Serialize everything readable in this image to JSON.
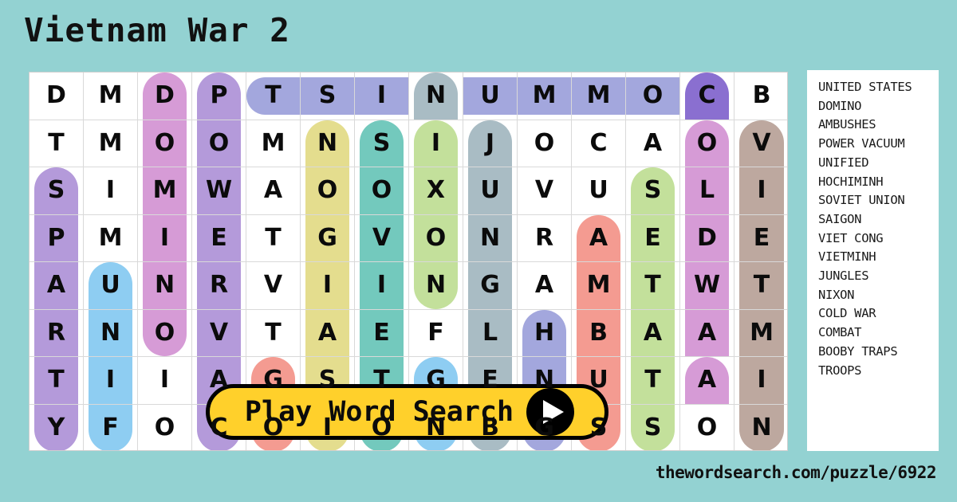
{
  "page": {
    "background_color": "#93d2d2",
    "title": "Vietnam War 2",
    "footer_url": "thewordsearch.com/puzzle/6922"
  },
  "play_button": {
    "label": "Play Word Search",
    "icon": "play-triangle-icon",
    "background_color": "#ffd02b",
    "text_color": "#0b0b0b"
  },
  "word_list": {
    "background_color": "#ffffff",
    "words": [
      "UNITED STATES",
      "DOMINO",
      "AMBUSHES",
      "POWER VACUUM",
      "UNIFIED",
      "HOCHIMINH",
      "SOVIET UNION",
      "SAIGON",
      "VIET CONG",
      "VIETMINH",
      "JUNGLES",
      "NIXON",
      "COLD WAR",
      "COMBAT",
      "BOOBY TRAPS",
      "TROOPS"
    ]
  },
  "grid": {
    "columns": 14,
    "rows": 8,
    "cell_background": "#ffffff",
    "border_color": "#d9d9d9",
    "highlight_colors": {
      "periwinkle": "#a3a7dd",
      "orchid": "#d69bd6",
      "violet": "#b49ada",
      "khaki": "#e4dd8e",
      "teal": "#73c9bd",
      "celery": "#c3e09b",
      "slate": "#a9bcc4",
      "salmon": "#f49b91",
      "taupe": "#bda89f",
      "sky": "#8ecdf2",
      "purple": "#8a6fd0"
    },
    "letters": [
      [
        "D",
        "M",
        "D",
        "P",
        "T",
        "S",
        "I",
        "N",
        "U",
        "M",
        "M",
        "O",
        "C",
        "B"
      ],
      [
        "T",
        "M",
        "O",
        "O",
        "M",
        "N",
        "S",
        "I",
        "J",
        "O",
        "C",
        "A",
        "O",
        "V"
      ],
      [
        "S",
        "I",
        "M",
        "W",
        "A",
        "O",
        "O",
        "X",
        "U",
        "V",
        "U",
        "S",
        "L",
        "I"
      ],
      [
        "P",
        "M",
        "I",
        "E",
        "T",
        "G",
        "V",
        "O",
        "N",
        "R",
        "A",
        "E",
        "D",
        "E"
      ],
      [
        "A",
        "U",
        "N",
        "R",
        "V",
        "I",
        "I",
        "N",
        "G",
        "A",
        "M",
        "T",
        "W",
        "T"
      ],
      [
        "R",
        "N",
        "O",
        "V",
        "T",
        "A",
        "E",
        "F",
        "L",
        "H",
        "B",
        "A",
        "A",
        "M"
      ],
      [
        "T",
        "I",
        "I",
        "A",
        "G",
        "S",
        "T",
        "G",
        "E",
        "N",
        "U",
        "T",
        "A",
        "I"
      ],
      [
        "Y",
        "F",
        "O",
        "C",
        "O",
        "I",
        "O",
        "N",
        "B",
        "G",
        "S",
        "S",
        "O",
        "N"
      ]
    ],
    "highlights": [
      [
        null,
        null,
        {
          "c": "orchid",
          "cap": "top"
        },
        {
          "c": "violet",
          "cap": "top"
        },
        {
          "c": "periwinkle",
          "cap": "left",
          "h": true
        },
        {
          "c": "periwinkle",
          "h": true
        },
        {
          "c": "periwinkle",
          "h": true
        },
        {
          "c": "slate",
          "cap": "top"
        },
        {
          "c": "periwinkle",
          "h": true
        },
        {
          "c": "periwinkle",
          "h": true
        },
        {
          "c": "periwinkle",
          "h": true
        },
        {
          "c": "periwinkle",
          "h": true
        },
        {
          "c": "purple",
          "cap": "top"
        },
        null
      ],
      [
        null,
        null,
        {
          "c": "orchid"
        },
        {
          "c": "violet"
        },
        null,
        {
          "c": "khaki",
          "cap": "top"
        },
        {
          "c": "teal",
          "cap": "top"
        },
        {
          "c": "celery",
          "cap": "top"
        },
        {
          "c": "slate",
          "cap": "top"
        },
        null,
        null,
        null,
        {
          "c": "orchid",
          "cap": "top"
        },
        {
          "c": "taupe",
          "cap": "top"
        }
      ],
      [
        {
          "c": "violet",
          "cap": "top"
        },
        null,
        {
          "c": "orchid"
        },
        {
          "c": "violet"
        },
        null,
        {
          "c": "khaki"
        },
        {
          "c": "teal"
        },
        {
          "c": "celery"
        },
        {
          "c": "slate"
        },
        null,
        null,
        {
          "c": "celery",
          "cap": "top"
        },
        {
          "c": "orchid"
        },
        {
          "c": "taupe"
        }
      ],
      [
        {
          "c": "violet"
        },
        null,
        {
          "c": "orchid"
        },
        {
          "c": "violet"
        },
        null,
        {
          "c": "khaki"
        },
        {
          "c": "teal"
        },
        {
          "c": "celery"
        },
        {
          "c": "slate"
        },
        null,
        {
          "c": "salmon",
          "cap": "top"
        },
        {
          "c": "celery"
        },
        {
          "c": "orchid"
        },
        {
          "c": "taupe"
        }
      ],
      [
        {
          "c": "violet"
        },
        {
          "c": "sky",
          "cap": "top"
        },
        {
          "c": "orchid"
        },
        {
          "c": "violet"
        },
        null,
        {
          "c": "khaki"
        },
        {
          "c": "teal"
        },
        {
          "c": "celery",
          "cap": "bottom"
        },
        {
          "c": "slate"
        },
        null,
        {
          "c": "salmon"
        },
        {
          "c": "celery"
        },
        {
          "c": "orchid"
        },
        {
          "c": "taupe"
        }
      ],
      [
        {
          "c": "violet"
        },
        {
          "c": "sky"
        },
        {
          "c": "orchid",
          "cap": "bottom"
        },
        {
          "c": "violet"
        },
        null,
        {
          "c": "khaki"
        },
        {
          "c": "teal"
        },
        null,
        {
          "c": "slate"
        },
        {
          "c": "periwinkle",
          "cap": "top"
        },
        {
          "c": "salmon"
        },
        {
          "c": "celery"
        },
        {
          "c": "orchid"
        },
        {
          "c": "taupe"
        }
      ],
      [
        {
          "c": "violet"
        },
        {
          "c": "sky"
        },
        null,
        {
          "c": "violet"
        },
        {
          "c": "salmon",
          "cap": "top"
        },
        {
          "c": "khaki"
        },
        {
          "c": "teal"
        },
        {
          "c": "sky",
          "cap": "top"
        },
        {
          "c": "slate"
        },
        {
          "c": "periwinkle"
        },
        {
          "c": "salmon"
        },
        {
          "c": "celery"
        },
        {
          "c": "orchid",
          "cap": "top"
        },
        {
          "c": "taupe"
        }
      ],
      [
        {
          "c": "violet",
          "cap": "bottom"
        },
        {
          "c": "sky",
          "cap": "bottom"
        },
        null,
        {
          "c": "violet",
          "cap": "bottom"
        },
        {
          "c": "salmon",
          "cap": "bottom"
        },
        {
          "c": "khaki",
          "cap": "bottom"
        },
        {
          "c": "teal",
          "cap": "bottom"
        },
        {
          "c": "sky",
          "cap": "bottom"
        },
        {
          "c": "slate",
          "cap": "bottom"
        },
        {
          "c": "periwinkle",
          "cap": "bottom"
        },
        {
          "c": "salmon",
          "cap": "bottom"
        },
        {
          "c": "celery",
          "cap": "bottom"
        },
        null,
        {
          "c": "taupe",
          "cap": "bottom"
        }
      ]
    ]
  }
}
